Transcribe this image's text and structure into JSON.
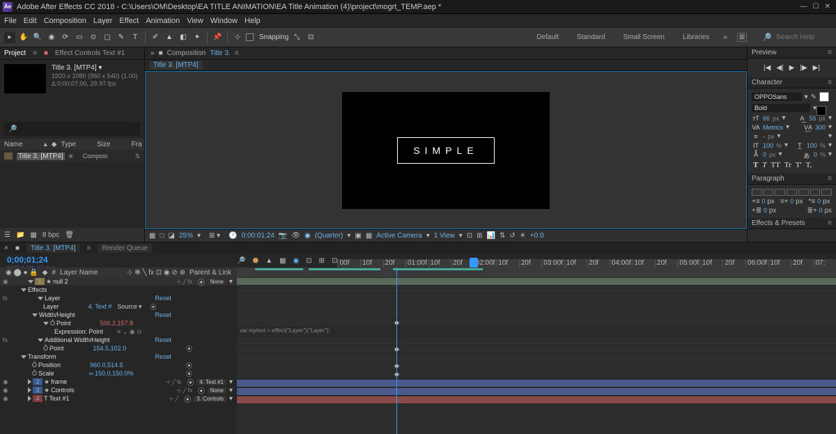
{
  "title": "Adobe After Effects CC 2018 - C:\\Users\\OM\\Desktop\\EA TITLE ANIMATION\\EA Title Animation (4)\\project\\mogrt_TEMP.aep *",
  "app_badge": "Ae",
  "menu": [
    "File",
    "Edit",
    "Composition",
    "Layer",
    "Effect",
    "Animation",
    "View",
    "Window",
    "Help"
  ],
  "snapping": "Snapping",
  "workspaces": [
    "Default",
    "Standard",
    "Small Screen",
    "Libraries"
  ],
  "search_placeholder": "Search Help",
  "project": {
    "tab1": "Project",
    "tab2": "Effect Controls Text #1",
    "comp_name": "Title 3. [MTP4] ▾",
    "res": "1920 x 1080  (960 x 540) (1.00)",
    "dur": "Δ 0;00;07;00, 29.97 fps",
    "cols": {
      "name": "Name",
      "type": "Type",
      "size": "Size",
      "fra": "Fra"
    },
    "row_name": "Title 3. [MTP4]",
    "row_type": "Composi",
    "bottom": {
      "bpc": "8 bpc"
    }
  },
  "comp": {
    "label": "Composition",
    "name": "Title 3.",
    "tab": "Title 3. [MTP4]",
    "box_text": "SIMPLE"
  },
  "viewer": {
    "zoom": "25%",
    "time": "0:00:01:24",
    "quality": "(Quarter)",
    "camera": "Active Camera",
    "view": "1 View",
    "exp": "+0.0"
  },
  "preview": {
    "title": "Preview"
  },
  "character": {
    "title": "Character",
    "font": "OPPOSans",
    "weight": "Bold",
    "size": "66",
    "leading": "55",
    "kern": "Metrics",
    "track": "300",
    "vscale": "100",
    "hscale": "100",
    "baseline": "0",
    "tsume": "0",
    "px": "px",
    "pct": "%",
    "styles": [
      "T",
      "T",
      "TT",
      "Tr",
      "T'",
      "T,"
    ]
  },
  "paragraph": {
    "title": "Paragraph",
    "indent": "0",
    "px": "px"
  },
  "effects": {
    "title": "Effects & Presets"
  },
  "timeline": {
    "tab": "Title 3. [MTP4]",
    "tab2": "Render Queue",
    "time": "0;00;01;24",
    "smpte": "00054 (29.97 fps)",
    "ruler": [
      "00f",
      "10f",
      "20f",
      "01:00f",
      "10f",
      "20f",
      "02:00f",
      "10f",
      "20f",
      "03:00f",
      "10f",
      "20f",
      "04:00f",
      "10f",
      "20f",
      "05:00f",
      "10f",
      "20f",
      "06:00f",
      "10f",
      "20f",
      "07:"
    ],
    "cols": {
      "num": "#",
      "layer": "Layer Name",
      "parent": "Parent & Link"
    },
    "layers": [
      {
        "num": "1",
        "name": "null 2"
      },
      {
        "name": "Effects",
        "section": true
      },
      {
        "name": "Layer",
        "reset": "Reset",
        "sub": true
      },
      {
        "name": "Layer",
        "value": "4. Text #",
        "src": "Source",
        "sub2": true
      },
      {
        "name": "Width/Height",
        "reset": "Reset",
        "sub": true
      },
      {
        "name": "Point",
        "value": "500.2,157.8",
        "red": true,
        "sub2": true,
        "kf": true
      },
      {
        "name": "Expression: Point",
        "expr": true,
        "sub3": true
      },
      {
        "name": "Additional Width/Height",
        "reset": "Reset",
        "sub": true
      },
      {
        "name": "Point",
        "value": "154.5,102.0",
        "sub2": true,
        "kf": true
      },
      {
        "name": "Transform",
        "reset": "Reset",
        "sub": true
      },
      {
        "name": "Position",
        "value": "960.0,514.5",
        "sub2": true,
        "kf": true
      },
      {
        "name": "Scale",
        "value": "150.0,150.0%",
        "sub2": true,
        "kf": true
      },
      {
        "num": "2",
        "name": "frame",
        "parent": "4. Text #1"
      },
      {
        "num": "3",
        "name": "Controls",
        "parent": "None"
      },
      {
        "num": "4",
        "name": "Text #1",
        "parent": "3. Controls"
      }
    ],
    "none": "None",
    "expr_text": "var mytext = effect(\"Layer\")(\"Layer\");"
  }
}
